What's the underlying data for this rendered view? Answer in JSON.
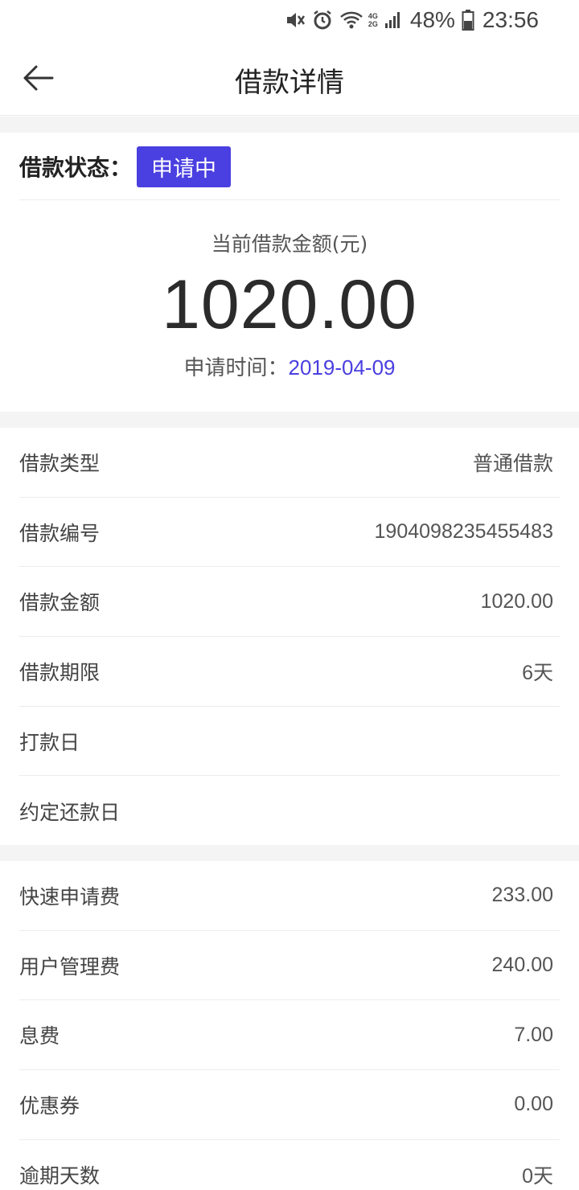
{
  "status_bar": {
    "battery_pct": "48%",
    "time": "23:56",
    "network_top": "4G",
    "network_bottom": "2G",
    "icons": [
      "mute-icon",
      "alarm-icon",
      "wifi-icon",
      "signal-icon",
      "battery-icon"
    ]
  },
  "header": {
    "title": "借款详情"
  },
  "loan_status": {
    "label": "借款状态：",
    "badge": "申请中",
    "badge_color": "#4a3fe0"
  },
  "amount": {
    "caption": "当前借款金额(元)",
    "value": "1020.00",
    "apply_time_label": "申请时间：",
    "apply_time_value": "2019-04-09"
  },
  "details": [
    {
      "label": "借款类型",
      "value": "普通借款"
    },
    {
      "label": "借款编号",
      "value": "1904098235455483"
    },
    {
      "label": "借款金额",
      "value": "1020.00"
    },
    {
      "label": "借款期限",
      "value": "6天"
    },
    {
      "label": "打款日",
      "value": ""
    },
    {
      "label": "约定还款日",
      "value": ""
    }
  ],
  "fees": [
    {
      "label": "快速申请费",
      "value": "233.00"
    },
    {
      "label": "用户管理费",
      "value": "240.00"
    },
    {
      "label": "息费",
      "value": "7.00"
    },
    {
      "label": "优惠券",
      "value": "0.00"
    },
    {
      "label": "逾期天数",
      "value": "0天"
    }
  ]
}
